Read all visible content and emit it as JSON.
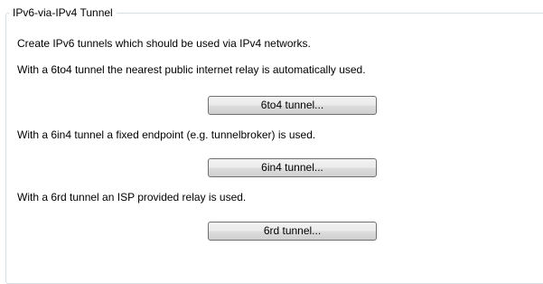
{
  "group": {
    "title": "IPv6-via-IPv4 Tunnel"
  },
  "content": {
    "intro": "Create IPv6 tunnels which should be used via IPv4 networks.",
    "sixtofour_text": "With a 6to4 tunnel the nearest public internet relay is automatically used.",
    "sixtofour_button": "6to4 tunnel...",
    "sixinfour_text": "With a 6in4 tunnel a fixed endpoint (e.g. tunnelbroker) is used.",
    "sixinfour_button": "6in4 tunnel...",
    "sixrd_text": "With a 6rd tunnel an ISP provided relay is used.",
    "sixrd_button": "6rd tunnel..."
  }
}
